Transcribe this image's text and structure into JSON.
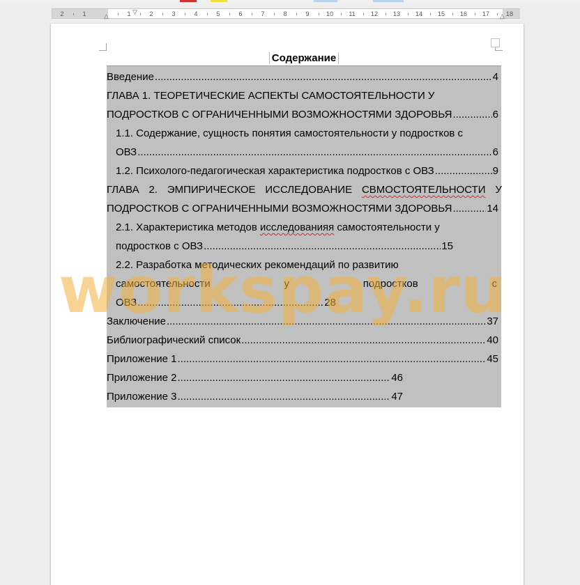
{
  "ruler": {
    "labels": [
      "2",
      "1",
      "1",
      "2",
      "3",
      "4",
      "5",
      "6",
      "7",
      "8",
      "9",
      "10",
      "11",
      "12",
      "13",
      "14",
      "15",
      "16",
      "17",
      "18"
    ]
  },
  "document": {
    "heading": "Содержание",
    "toc": [
      {
        "text": "Введение",
        "page": "4",
        "level": 1
      },
      {
        "text": "ГЛАВА 1. ТЕОРЕТИЧЕСКИЕ АСПЕКТЫ САМОСТОЯТЕЛЬНОСТИ У",
        "page": "",
        "level": 1
      },
      {
        "text": "ПОДРОСТКОВ С ОГРАНИЧЕННЫМИ ВОЗМОЖНОСТЯМИ ЗДОРОВЬЯ",
        "page": "6",
        "level": 1
      },
      {
        "text": "1.1.  Содержание, сущность понятия самостоятельности у подростков с",
        "page": "",
        "level": 2
      },
      {
        "text": "ОВЗ",
        "page": "6",
        "level": 2
      },
      {
        "text": "1.2.  Психолого-педагогическая характеристика подростков с ОВЗ",
        "page": "9",
        "level": 2
      },
      {
        "text": "ГЛАВА 2. ЭМПИРИЧЕСКОЕ ИССЛЕДОВАНИЕ СВМОСТОЯТЕЛЬНОСТИ У",
        "page": "",
        "level": 1
      },
      {
        "text": "ПОДРОСТКОВ С ОГРАНИЧЕННЫМИ ВОЗМОЖНОСТЯМИ ЗДОРОВЬЯ",
        "page": "14",
        "level": 1
      },
      {
        "text": "2.1.  Характеристика методов исследованияя самостоятельности у",
        "page": "",
        "level": 2
      },
      {
        "text": "подростков с ОВЗ",
        "page": "15",
        "level": 2
      },
      {
        "text": "2.2.      Разработка методических рекомендаций по развитию",
        "page": "",
        "level": 2
      },
      {
        "text": "самостоятельности у подростков с",
        "page": "",
        "level": 2
      },
      {
        "text": "ОВЗ",
        "page": "28",
        "level": 2
      },
      {
        "text": "Заключение",
        "page": "37",
        "level": 1
      },
      {
        "text": "Библиографический список",
        "page": "40",
        "level": 1
      },
      {
        "text": "Приложение 1",
        "page": "45",
        "level": 1
      },
      {
        "text": "Приложение 2",
        "page": "46",
        "level": 1
      },
      {
        "text": "Приложение 3",
        "page": "47",
        "level": 1
      }
    ],
    "justified_words": [
      "самостоятельности",
      "у",
      "подростков",
      "с"
    ],
    "ch2_words": [
      "ГЛАВА",
      "2.",
      "ЭМПИРИЧЕСКОЕ",
      "ИССЛЕДОВАНИЕ",
      "СВМОСТОЯТЕЛЬНОСТИ",
      "У"
    ]
  },
  "watermark": "workspay.ru",
  "colors": {
    "field_shading": "#c0c0c0",
    "watermark": "#f2b03c",
    "spell_error": "#e02020"
  }
}
